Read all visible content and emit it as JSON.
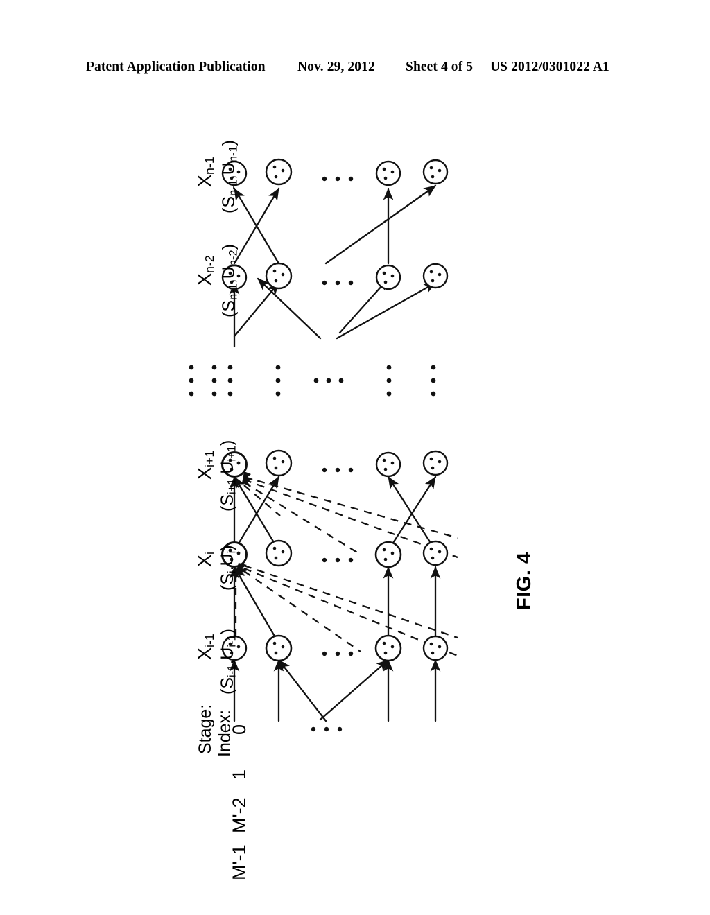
{
  "header": {
    "title": "Patent Application Publication",
    "date": "Nov. 29, 2012",
    "sheet": "Sheet 4 of 5",
    "publication_number": "US 2012/0301022 A1"
  },
  "figure": {
    "caption": "FIG. 4",
    "stage_axis_label": "Stage:",
    "index_axis_label": "Index:",
    "index_values": [
      "0",
      "1",
      "• • •",
      "M'-2",
      "M'-1"
    ],
    "vertical_ellipsis": "⋮",
    "horizontal_ellipsis": "• • •",
    "upper_block": {
      "stages": [
        {
          "variable": "X",
          "variable_sub": "n-2",
          "pair": "(S",
          "pair_sub1": "n-1",
          "pair_mid": ",U",
          "pair_sub2": "n-2",
          "pair_end": ")",
          "pair_full": "(Sn-1,Un-2)"
        },
        {
          "variable": "X",
          "variable_sub": "n-1",
          "pair": "(S",
          "pair_sub1": "n-1",
          "pair_mid": ",U",
          "pair_sub2": "n-1",
          "pair_end": ")",
          "pair_full": "(Sn-1,Un-1)"
        }
      ]
    },
    "lower_block": {
      "stages": [
        {
          "variable": "X",
          "variable_sub": "i-1",
          "pair_full": "(Si-1,Ui-1)"
        },
        {
          "variable": "X",
          "variable_sub": "i",
          "pair_full": "(Si,Ui)"
        },
        {
          "variable": "X",
          "variable_sub": "i+1",
          "pair_full": "(Si+1,Ui+1)"
        }
      ]
    },
    "node_count_per_stage": 4,
    "line_styles": {
      "transition": "solid-arrow",
      "pruned": "dashed"
    },
    "colors": {
      "ink": "#000000",
      "background": "#ffffff"
    }
  }
}
